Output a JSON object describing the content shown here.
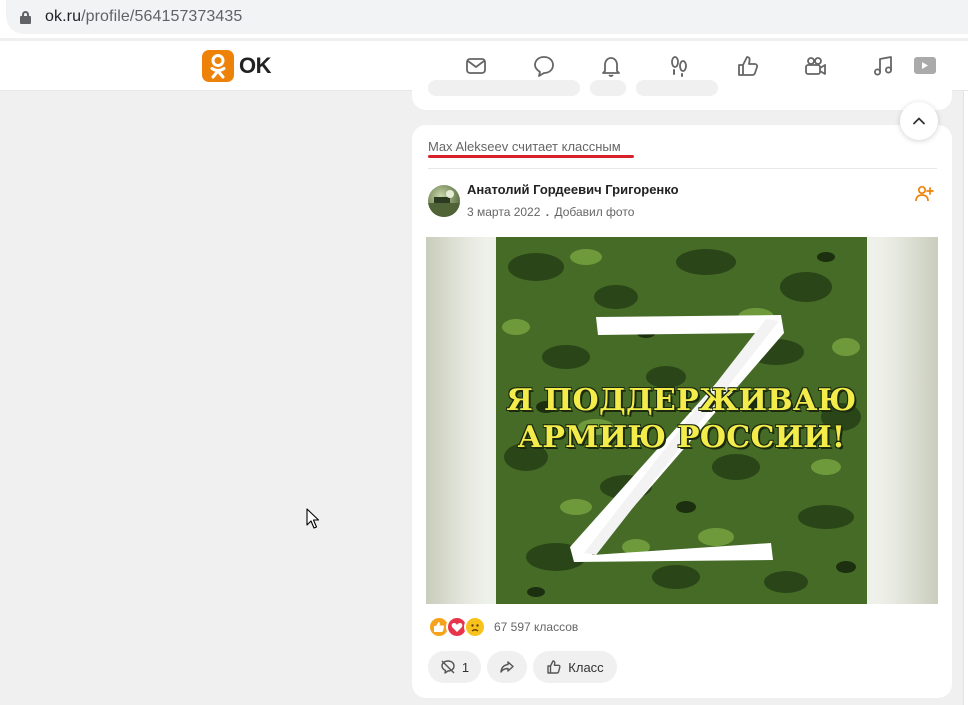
{
  "browser": {
    "url_domain": "ok.ru",
    "url_path": "/profile/564157373435"
  },
  "header": {
    "logo_text": "OK",
    "nav_icons": [
      "mail-icon",
      "chat-icon",
      "bell-icon",
      "footprints-icon",
      "thumb-up-icon",
      "video-camera-icon",
      "music-note-icon",
      "video-play-icon"
    ],
    "brand_color": "#ee8208"
  },
  "post": {
    "liked_by": "Max Alekseev считает классным",
    "author": "Анатолий Гордеевич Григоренко",
    "date": "3 марта 2022",
    "separator": ".",
    "action": "Добавил фото",
    "image_text_line1": "Я ПОДДЕРЖИВАЮ",
    "image_text_line2": "АРМИЮ РОССИИ!",
    "reactions_count": "67 597 классов",
    "comments_count": "1",
    "like_label": "Класс",
    "highlight_color": "#d8222a"
  }
}
